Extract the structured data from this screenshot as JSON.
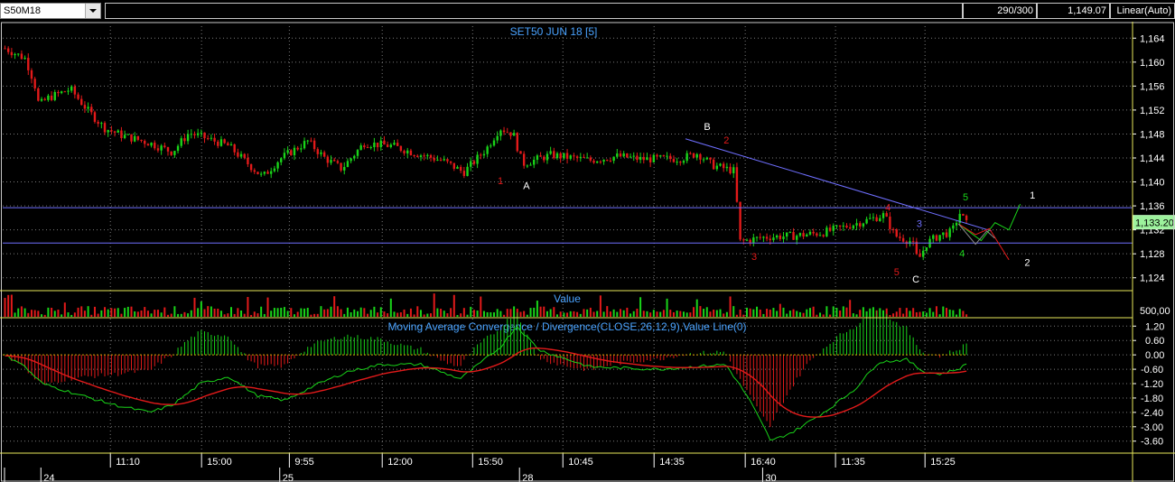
{
  "toolbar": {
    "symbol": "S50M18",
    "bars_count": "290/300",
    "last_price": "1,149.07",
    "scale_mode": "Linear(Auto)"
  },
  "colors": {
    "bull": "#19d419",
    "bear": "#e21a1a",
    "trendline": "#6f6fff",
    "grid": "#7a7a7a",
    "panel_border": "#e8e85a",
    "title": "#4aa3ff",
    "price_badge_bg": "#9cf29c"
  },
  "chart_data": [
    {
      "type": "candlestick",
      "title": "SET50 JUN 18   [5]",
      "y_ticks": [
        "1,164",
        "1,160",
        "1,156",
        "1,152",
        "1,148",
        "1,144",
        "1,140",
        "1,136",
        "1,132",
        "1,128",
        "1,124"
      ],
      "ylim": [
        1122,
        1166
      ],
      "current_price_label": "1,133.20",
      "current_price": 1133.2,
      "horizontal_lines": [
        1135.7,
        1129.8
      ],
      "trendline": {
        "from": [
          0.6043,
          1147.2
        ],
        "to": [
          0.8753,
          1131.8
        ]
      },
      "wave_labels": [
        {
          "text": "1",
          "x": 0.4405,
          "y": 1139.6,
          "color": "#e21a1a"
        },
        {
          "text": "A",
          "x": 0.4636,
          "y": 1138.8,
          "color": "#ffffff"
        },
        {
          "text": "B",
          "x": 0.6235,
          "y": 1148.7,
          "color": "#ffffff"
        },
        {
          "text": "2",
          "x": 0.6405,
          "y": 1146.4,
          "color": "#e21a1a"
        },
        {
          "text": "3",
          "x": 0.6651,
          "y": 1127.0,
          "color": "#e21a1a"
        },
        {
          "text": "4",
          "x": 0.7835,
          "y": 1135.2,
          "color": "#e21a1a"
        },
        {
          "text": "3",
          "x": 0.8113,
          "y": 1132.5,
          "color": "#6f6fff"
        },
        {
          "text": "5",
          "x": 0.7912,
          "y": 1124.4,
          "color": "#e21a1a"
        },
        {
          "text": "C",
          "x": 0.8082,
          "y": 1123.2,
          "color": "#ffffff"
        },
        {
          "text": "5",
          "x": 0.8522,
          "y": 1136.9,
          "color": "#19d419"
        },
        {
          "text": "4",
          "x": 0.8491,
          "y": 1127.5,
          "color": "#19d419"
        },
        {
          "text": "1",
          "x": 0.9114,
          "y": 1137.2,
          "color": "#ffffff"
        },
        {
          "text": "2",
          "x": 0.9068,
          "y": 1126.0,
          "color": "#ffffff"
        }
      ],
      "projection_paths": [
        {
          "color": "#19d419",
          "points": [
            [
              0.846,
              1133.0
            ],
            [
              0.866,
              1130.2
            ],
            [
              0.8783,
              1133.2
            ],
            [
              0.8906,
              1132.0
            ],
            [
              0.9006,
              1136.3
            ]
          ]
        },
        {
          "color": "#e21a1a",
          "points": [
            [
              0.846,
              1133.0
            ],
            [
              0.861,
              1131.2
            ],
            [
              0.8733,
              1132.2
            ],
            [
              0.8906,
              1127.0
            ]
          ]
        },
        {
          "color": "#8a8a8a",
          "points": [
            [
              0.846,
              1133.0
            ],
            [
              0.861,
              1129.6
            ],
            [
              0.871,
              1131.8
            ],
            [
              0.878,
              1130.6
            ]
          ]
        }
      ]
    },
    {
      "type": "bar",
      "title": "Value",
      "y_ticks": [
        "500,00"
      ]
    },
    {
      "type": "macd",
      "title": "Moving Average Convergence / Divergence(CLOSE,26,12,9),Value Line(0)",
      "y_ticks": [
        "1.20",
        "0.60",
        "0.00",
        "-0.60",
        "-1.20",
        "-1.80",
        "-2.40",
        "-3.00",
        "-3.60"
      ],
      "ylim": [
        -4.1,
        1.55
      ]
    }
  ],
  "x_axis": {
    "time_labels": [
      {
        "text": "11:10",
        "x": 0.0953
      },
      {
        "text": "15:00",
        "x": 0.176
      },
      {
        "text": "9:55",
        "x": 0.2537
      },
      {
        "text": "12:00",
        "x": 0.3359
      },
      {
        "text": "15:50",
        "x": 0.4159
      },
      {
        "text": "10:45",
        "x": 0.4958
      },
      {
        "text": "14:35",
        "x": 0.5765
      },
      {
        "text": "16:40",
        "x": 0.6572
      },
      {
        "text": "11:35",
        "x": 0.7371
      },
      {
        "text": "15:25",
        "x": 0.8163
      }
    ],
    "day_labels": [
      {
        "text": "24",
        "x": 0.0338
      },
      {
        "text": "25",
        "x": 0.2452
      },
      {
        "text": "28",
        "x": 0.4574
      },
      {
        "text": "30",
        "x": 0.6726
      }
    ]
  }
}
